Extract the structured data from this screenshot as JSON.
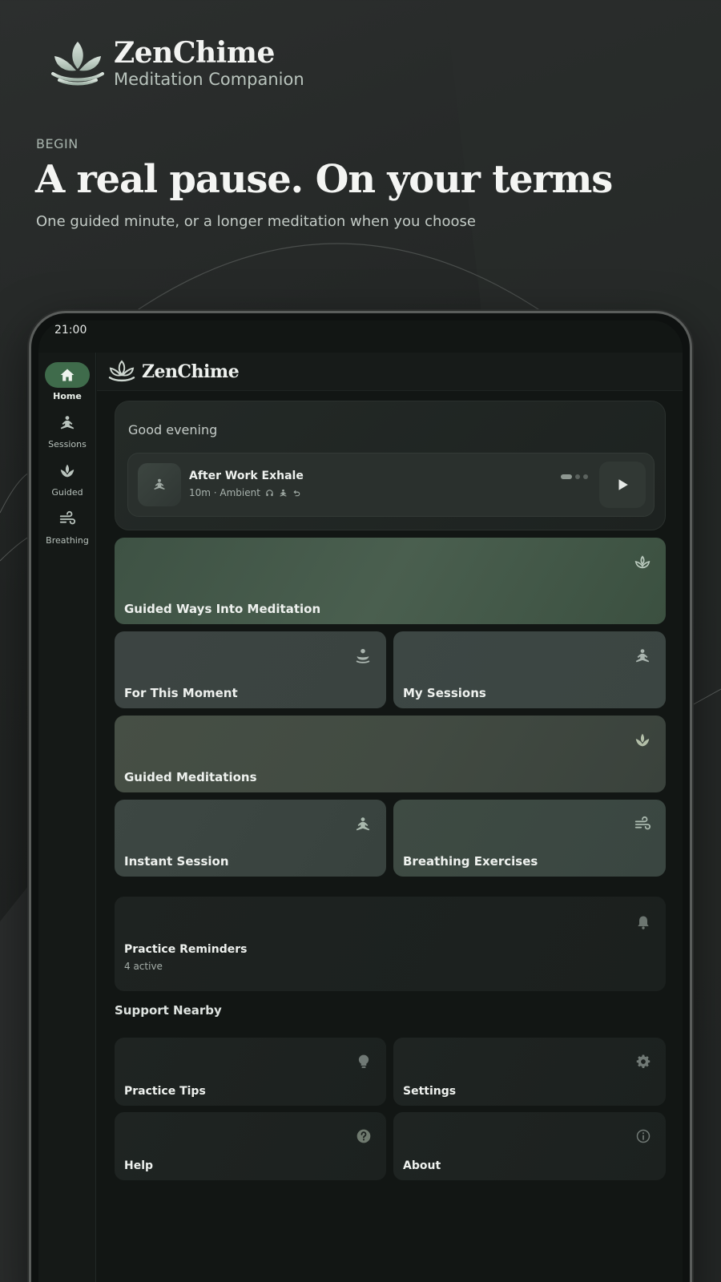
{
  "promo": {
    "brand": "ZenChime",
    "brand_sub": "Meditation Companion",
    "eyebrow": "BEGIN",
    "headline": "A real pause. On your terms",
    "subhead": "One guided minute, or a longer meditation when you choose"
  },
  "status": {
    "time": "21:00"
  },
  "app": {
    "title": "ZenChime"
  },
  "rail": {
    "items": [
      {
        "label": "Home",
        "icon": "home-icon",
        "active": true
      },
      {
        "label": "Sessions",
        "icon": "meditation-person-icon",
        "active": false
      },
      {
        "label": "Guided",
        "icon": "lotus-icon",
        "active": false
      },
      {
        "label": "Breathing",
        "icon": "wind-icon",
        "active": false
      }
    ]
  },
  "greeting": {
    "text": "Good evening",
    "player": {
      "title": "After Work Exhale",
      "meta": "10m · Ambient",
      "page_index": 1,
      "page_count": 3
    }
  },
  "tiles": {
    "guided_ways": "Guided Ways Into Meditation",
    "for_this_moment": "For This Moment",
    "my_sessions": "My Sessions",
    "guided_meditations": "Guided Meditations",
    "instant_session": "Instant Session",
    "breathing_exercises": "Breathing Exercises"
  },
  "reminders": {
    "title": "Practice Reminders",
    "subtitle": "4 active"
  },
  "support": {
    "title": "Support Nearby",
    "practice_tips": "Practice Tips",
    "settings": "Settings",
    "help": "Help",
    "about": "About"
  },
  "colors": {
    "accent": "#3f6b4b",
    "background": "#121614",
    "tile_green": "#46594b",
    "tile_slate": "#3b4542"
  }
}
